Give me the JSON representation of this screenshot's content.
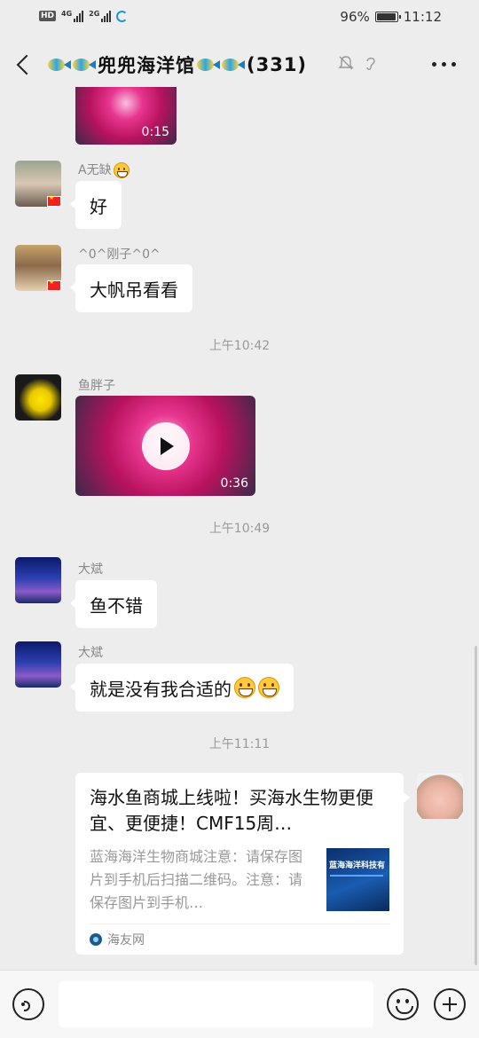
{
  "status_bar": {
    "hd": "HD",
    "sim1_tag": "4G",
    "sim2_tag": "2G",
    "battery": "96%",
    "battery_level": 0.96,
    "time": "11:12"
  },
  "header": {
    "title": "兜兜海洋馆",
    "member_count": "(331)",
    "icons": [
      "back-icon",
      "fish-emoji",
      "mute-icon",
      "ear-icon",
      "more-icon"
    ]
  },
  "messages": {
    "video1_duration": "0:15",
    "m1": {
      "sender": "A无缺",
      "text": "好"
    },
    "m2": {
      "sender": "^0^刚子^0^",
      "text": "大帆吊看看"
    },
    "time1": "上午10:42",
    "m3": {
      "sender": "鱼胖子",
      "video_duration": "0:36"
    },
    "time2": "上午10:49",
    "m4": {
      "sender": "大斌",
      "text": "鱼不错"
    },
    "m5": {
      "sender": "大斌",
      "text": "就是没有我合适的"
    },
    "time3": "上午11:11"
  },
  "link_card": {
    "title": "海水鱼商城上线啦！买海水生物更便宜、更便捷！CMF15周…",
    "description": "蓝海海洋生物商城注意：请保存图片到手机后扫描二维码。注意：请保存图片到手机…",
    "thumb_text": "蓝海海洋科技有",
    "source": "海友网"
  },
  "input_bar": {
    "placeholder": ""
  }
}
